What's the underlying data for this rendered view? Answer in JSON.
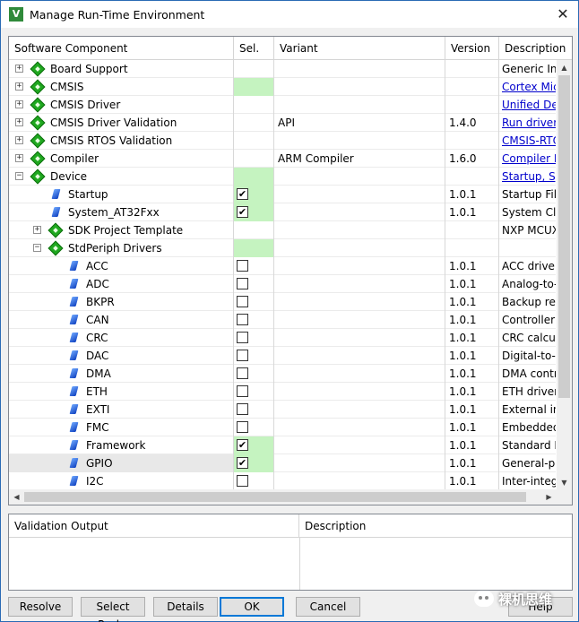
{
  "window": {
    "title": "Manage Run-Time Environment",
    "close_glyph": "✕"
  },
  "columns": {
    "name": "Software Component",
    "sel": "Sel.",
    "variant": "Variant",
    "version": "Version",
    "description": "Description"
  },
  "rows": [
    {
      "name": "Board Support",
      "level": 0,
      "icon": "diamond",
      "expander": "+",
      "sel": "none",
      "variant": "",
      "version": "",
      "desc": "Generic Inte",
      "link": false
    },
    {
      "name": "CMSIS",
      "level": 0,
      "icon": "diamond",
      "expander": "+",
      "sel": "green",
      "variant": "",
      "version": "",
      "desc": "Cortex Micr",
      "link": true
    },
    {
      "name": "CMSIS Driver",
      "level": 0,
      "icon": "diamond",
      "expander": "+",
      "sel": "none",
      "variant": "",
      "version": "",
      "desc": "Unified Dev",
      "link": true
    },
    {
      "name": "CMSIS Driver Validation",
      "level": 0,
      "icon": "diamond",
      "expander": "+",
      "sel": "none",
      "variant": "API",
      "version": "1.4.0",
      "desc": "Run driver v",
      "link": true
    },
    {
      "name": "CMSIS RTOS Validation",
      "level": 0,
      "icon": "diamond",
      "expander": "+",
      "sel": "none",
      "variant": "",
      "version": "",
      "desc": "CMSIS-RTO",
      "link": true
    },
    {
      "name": "Compiler",
      "level": 0,
      "icon": "diamond",
      "expander": "+",
      "sel": "none",
      "variant": "ARM Compiler",
      "version": "1.6.0",
      "desc": "Compiler E",
      "link": true
    },
    {
      "name": "Device",
      "level": 0,
      "icon": "diamond",
      "expander": "−",
      "sel": "green",
      "variant": "",
      "version": "",
      "desc": "Startup, Sys",
      "link": true
    },
    {
      "name": "Startup",
      "level": 1,
      "icon": "gem",
      "expander": "",
      "sel": "checked-green",
      "variant": "",
      "version": "1.0.1",
      "desc": "Startup File",
      "link": false
    },
    {
      "name": "System_AT32Fxx",
      "level": 1,
      "icon": "gem",
      "expander": "",
      "sel": "checked-green",
      "variant": "",
      "version": "1.0.1",
      "desc": "System Clo",
      "link": false
    },
    {
      "name": "SDK Project Template",
      "level": 1,
      "icon": "diamond",
      "expander": "+",
      "sel": "none",
      "variant": "",
      "version": "",
      "desc": "NXP MCUX",
      "link": false
    },
    {
      "name": "StdPeriph Drivers",
      "level": 1,
      "icon": "diamond",
      "expander": "−",
      "sel": "green",
      "variant": "",
      "version": "",
      "desc": "",
      "link": false
    },
    {
      "name": "ACC",
      "level": 2,
      "icon": "gem",
      "expander": "",
      "sel": "unchecked",
      "variant": "",
      "version": "1.0.1",
      "desc": "ACC driver",
      "link": false
    },
    {
      "name": "ADC",
      "level": 2,
      "icon": "gem",
      "expander": "",
      "sel": "unchecked",
      "variant": "",
      "version": "1.0.1",
      "desc": "Analog-to-",
      "link": false
    },
    {
      "name": "BKPR",
      "level": 2,
      "icon": "gem",
      "expander": "",
      "sel": "unchecked",
      "variant": "",
      "version": "1.0.1",
      "desc": "Backup reg",
      "link": false
    },
    {
      "name": "CAN",
      "level": 2,
      "icon": "gem",
      "expander": "",
      "sel": "unchecked",
      "variant": "",
      "version": "1.0.1",
      "desc": "Controller a",
      "link": false
    },
    {
      "name": "CRC",
      "level": 2,
      "icon": "gem",
      "expander": "",
      "sel": "unchecked",
      "variant": "",
      "version": "1.0.1",
      "desc": "CRC calcul",
      "link": false
    },
    {
      "name": "DAC",
      "level": 2,
      "icon": "gem",
      "expander": "",
      "sel": "unchecked",
      "variant": "",
      "version": "1.0.1",
      "desc": "Digital-to-a",
      "link": false
    },
    {
      "name": "DMA",
      "level": 2,
      "icon": "gem",
      "expander": "",
      "sel": "unchecked",
      "variant": "",
      "version": "1.0.1",
      "desc": "DMA contr",
      "link": false
    },
    {
      "name": "ETH",
      "level": 2,
      "icon": "gem",
      "expander": "",
      "sel": "unchecked",
      "variant": "",
      "version": "1.0.1",
      "desc": "ETH driver",
      "link": false
    },
    {
      "name": "EXTI",
      "level": 2,
      "icon": "gem",
      "expander": "",
      "sel": "unchecked",
      "variant": "",
      "version": "1.0.1",
      "desc": "External int",
      "link": false
    },
    {
      "name": "FMC",
      "level": 2,
      "icon": "gem",
      "expander": "",
      "sel": "unchecked",
      "variant": "",
      "version": "1.0.1",
      "desc": "Embedded",
      "link": false
    },
    {
      "name": "Framework",
      "level": 2,
      "icon": "gem",
      "expander": "",
      "sel": "checked-green",
      "variant": "",
      "version": "1.0.1",
      "desc": "Standard P",
      "link": false
    },
    {
      "name": "GPIO",
      "level": 2,
      "icon": "gem",
      "expander": "",
      "sel": "checked-green",
      "variant": "",
      "version": "1.0.1",
      "desc": "General-pu",
      "link": false,
      "selected": true
    },
    {
      "name": "I2C",
      "level": 2,
      "icon": "gem",
      "expander": "",
      "sel": "unchecked",
      "variant": "",
      "version": "1.0.1",
      "desc": "Inter-integr",
      "link": false
    }
  ],
  "validation": {
    "col_output": "Validation Output",
    "col_description": "Description"
  },
  "buttons": {
    "resolve": "Resolve",
    "select_packs": "Select Packs",
    "details": "Details",
    "ok": "OK",
    "cancel": "Cancel",
    "help": "Help"
  },
  "watermark": {
    "text": "裸机思维"
  },
  "colors": {
    "selected_green": "#c5f3c0",
    "link_blue": "#0000cc",
    "diamond_green": "#1fa81f",
    "window_border": "#2a6bb5"
  }
}
